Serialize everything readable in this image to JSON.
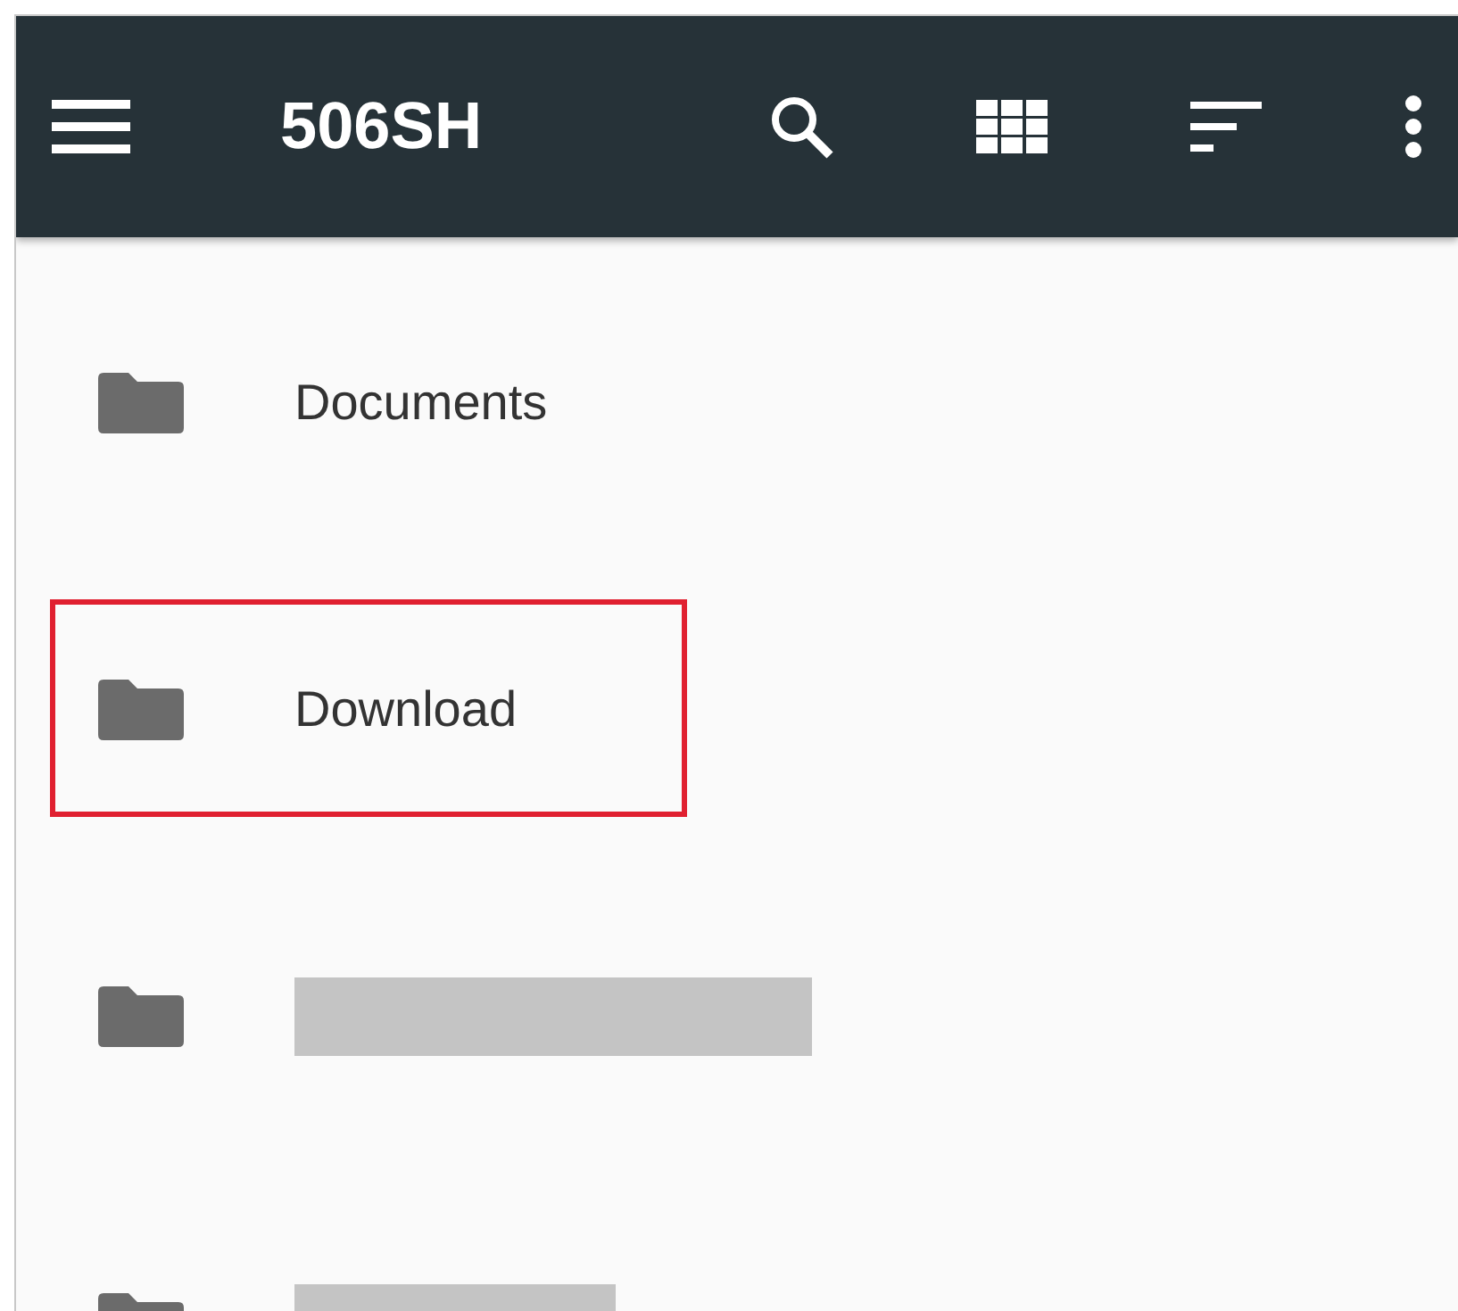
{
  "toolbar": {
    "title": "506SH"
  },
  "items": [
    {
      "kind": "named",
      "name": "Documents",
      "highlighted": false
    },
    {
      "kind": "named",
      "name": "Download",
      "highlighted": true
    },
    {
      "kind": "redacted",
      "highlighted": false
    },
    {
      "kind": "redacted",
      "highlighted": false
    }
  ]
}
